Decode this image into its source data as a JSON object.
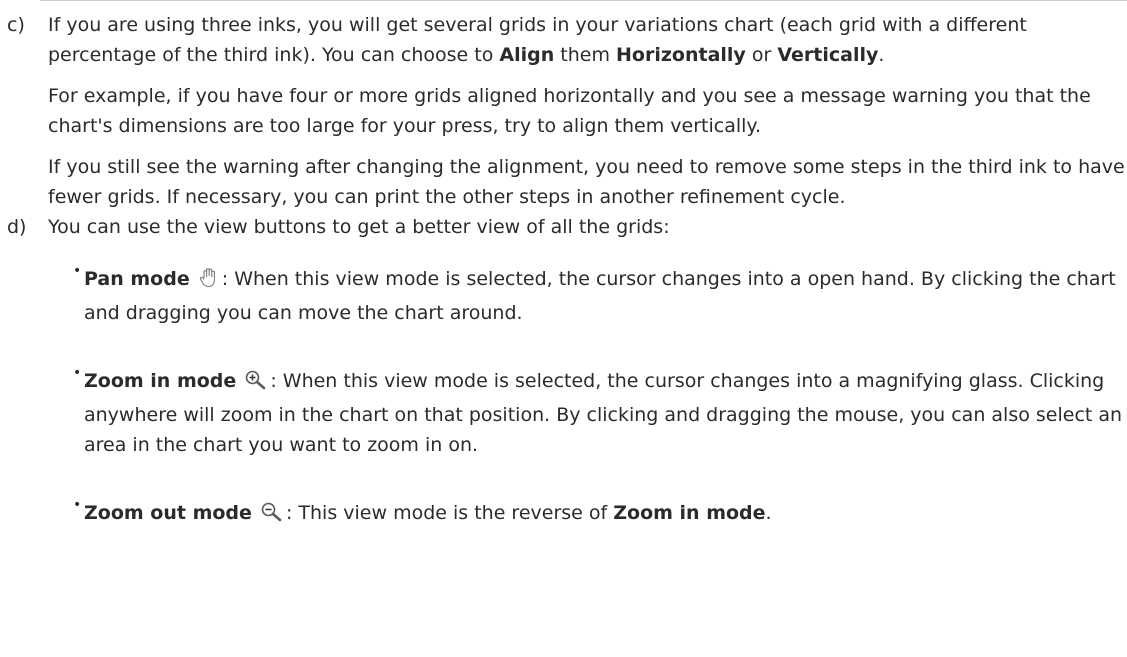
{
  "item_c": {
    "marker": "c)",
    "lead_1": "If you are using three inks, you will get several grids in your variations chart (each grid with a different percentage of the third ink). You can choose to ",
    "align": "Align",
    "lead_2": " them ",
    "horizontally": "Horizontally",
    "lead_3": " or ",
    "vertically": "Vertically",
    "lead_4": ".",
    "para_1": "For example, if you have four or more grids aligned horizontally and you see a message warning you that the chart's dimensions are too large for your press, try to align them vertically.",
    "para_2": "If you still see the warning after changing the alignment, you need to remove some steps in the third ink to have fewer grids. If necessary, you can print the other steps in another refinement cycle."
  },
  "item_d": {
    "marker": "d)",
    "lead": "You can use the view buttons to get a better view of all the grids:",
    "bullets": [
      {
        "title": "Pan mode",
        "icon": "hand-icon",
        "text": ": When this view mode is selected, the cursor changes into a open hand. By clicking the chart and dragging you can move the chart around."
      },
      {
        "title": "Zoom in mode",
        "icon": "zoom-in-icon",
        "text": ": When this view mode is selected, the cursor changes into a magnifying glass. Clicking anywhere will zoom in the chart on that position. By clicking and dragging the mouse, you can also select an area in the chart you want to zoom in on."
      },
      {
        "title": "Zoom out mode",
        "icon": "zoom-out-icon",
        "text_1": ": This view mode is the reverse of ",
        "ref": "Zoom in mode",
        "text_2": "."
      }
    ]
  }
}
